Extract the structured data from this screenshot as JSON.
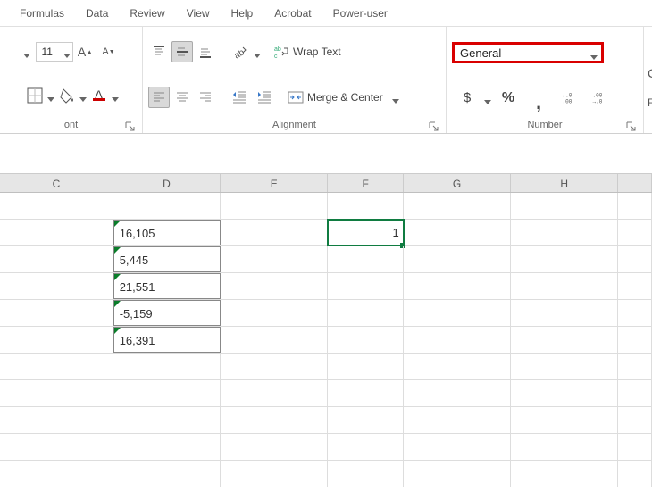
{
  "tabs": [
    "Formulas",
    "Data",
    "Review",
    "View",
    "Help",
    "Acrobat",
    "Power-user"
  ],
  "font": {
    "size": "11",
    "group_label": "ont"
  },
  "alignment": {
    "wrap_text": "Wrap Text",
    "merge_center": "Merge & Center",
    "group_label": "Alignment"
  },
  "number": {
    "format_selected": "General",
    "group_label": "Number",
    "currency": "$",
    "percent": "%",
    "comma": ",",
    "dec_inc_symbol": "←0\n.00",
    "dec_dec_symbol": ".00\n→0"
  },
  "extra": {
    "c": "C",
    "f": "Fc"
  },
  "columns": [
    "C",
    "D",
    "E",
    "F",
    "G",
    "H",
    ""
  ],
  "cells": {
    "d": [
      "16,105",
      "5,445",
      "21,551",
      "-5,159",
      "16,391"
    ],
    "f_selected": "1"
  }
}
